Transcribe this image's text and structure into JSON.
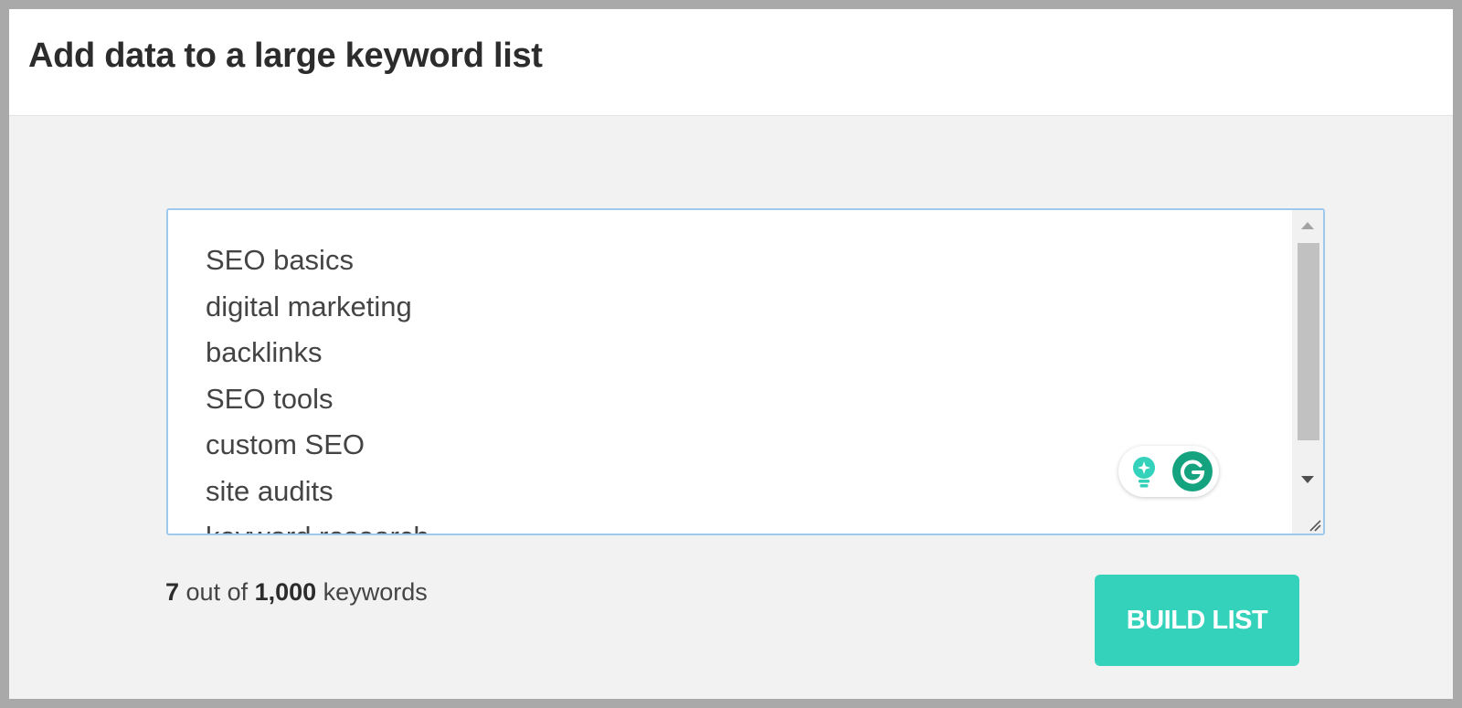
{
  "header": {
    "title": "Add data to a large keyword list"
  },
  "keyword_input": {
    "lines": [
      "SEO basics",
      "digital marketing",
      "backlinks",
      "SEO tools",
      "custom SEO",
      "site audits",
      "keyword research"
    ],
    "scroll_position": 0.0
  },
  "counter": {
    "count": "7",
    "middle": " out of ",
    "limit": "1,000",
    "suffix": " keywords"
  },
  "actions": {
    "build_label": "BUILD LIST"
  },
  "icons": {
    "suggestions": "lightbulb-icon",
    "assistant": "grammarly-icon",
    "resize": "resize-handle-icon"
  },
  "colors": {
    "accent": "#34d2bb",
    "assistant_green": "#15a37f",
    "input_border": "#9fc8ee",
    "background": "#f2f2f2"
  }
}
